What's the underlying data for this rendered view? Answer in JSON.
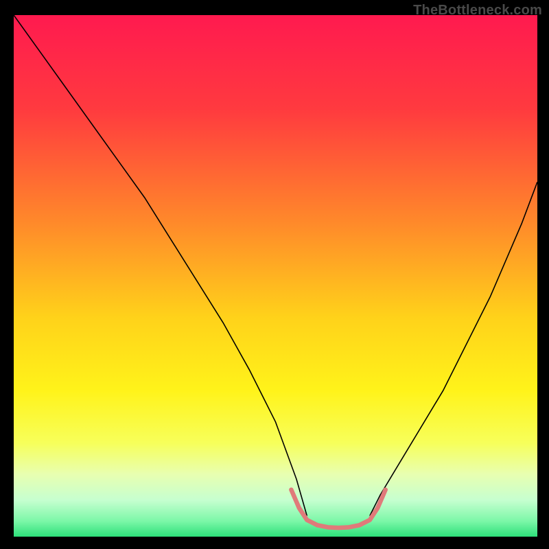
{
  "watermark": "TheBottleneck.com",
  "chart_data": {
    "type": "line",
    "title": "",
    "xlabel": "",
    "ylabel": "",
    "xlim": [
      0,
      100
    ],
    "ylim": [
      0,
      100
    ],
    "gradient_stops": [
      {
        "offset": 0,
        "color": "#ff1a4f"
      },
      {
        "offset": 18,
        "color": "#ff3a3f"
      },
      {
        "offset": 40,
        "color": "#ff8a2a"
      },
      {
        "offset": 58,
        "color": "#ffd21a"
      },
      {
        "offset": 72,
        "color": "#fff31a"
      },
      {
        "offset": 82,
        "color": "#f7ff5a"
      },
      {
        "offset": 88,
        "color": "#e8ffb0"
      },
      {
        "offset": 93,
        "color": "#c6ffd0"
      },
      {
        "offset": 97,
        "color": "#7cf7a8"
      },
      {
        "offset": 100,
        "color": "#2de07a"
      }
    ],
    "series": [
      {
        "name": "left-curve",
        "color": "#000000",
        "width": 1.6,
        "x": [
          0,
          5,
          10,
          15,
          20,
          25,
          30,
          35,
          40,
          45,
          50,
          54,
          56
        ],
        "y": [
          100,
          93,
          86,
          79,
          72,
          65,
          57,
          49,
          41,
          32,
          22,
          11,
          4
        ]
      },
      {
        "name": "right-curve",
        "color": "#000000",
        "width": 1.6,
        "x": [
          68,
          70,
          73,
          76,
          79,
          82,
          85,
          88,
          91,
          94,
          97,
          100
        ],
        "y": [
          4,
          8,
          13,
          18,
          23,
          28,
          34,
          40,
          46,
          53,
          60,
          68
        ]
      },
      {
        "name": "highlight-band",
        "color": "#e07a7a",
        "width": 6.5,
        "linecap": "round",
        "x": [
          53,
          54.5,
          56,
          58,
          60,
          62,
          64,
          66,
          68,
          69.5,
          71
        ],
        "y": [
          9,
          5.5,
          3.2,
          2.2,
          1.8,
          1.7,
          1.8,
          2.2,
          3.2,
          5.5,
          9
        ]
      }
    ]
  }
}
